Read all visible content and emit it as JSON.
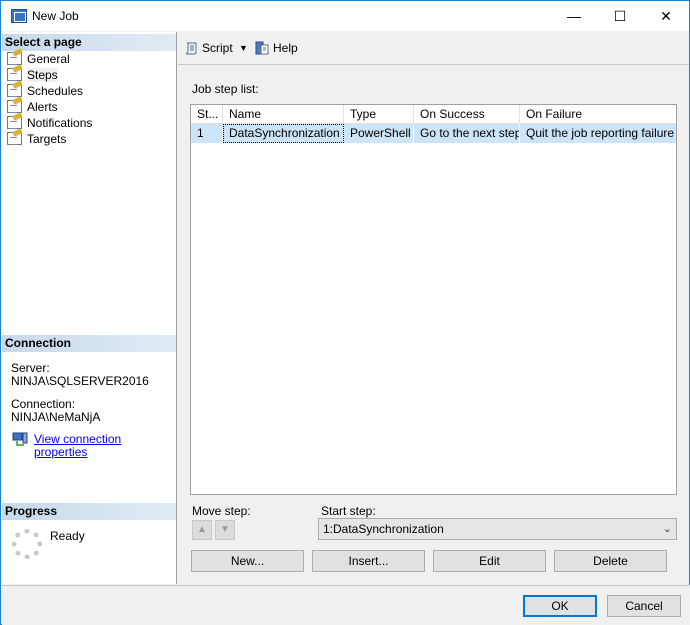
{
  "window": {
    "title": "New Job",
    "minimize": "—",
    "maximize": "☐",
    "close": "✕"
  },
  "left_panel": {
    "select_page_header": "Select a page",
    "pages": [
      {
        "label": "General",
        "icon": "page-icon"
      },
      {
        "label": "Steps",
        "icon": "page-icon",
        "selected": true
      },
      {
        "label": "Schedules",
        "icon": "page-icon"
      },
      {
        "label": "Alerts",
        "icon": "page-icon"
      },
      {
        "label": "Notifications",
        "icon": "page-icon"
      },
      {
        "label": "Targets",
        "icon": "page-icon"
      }
    ],
    "connection_header": "Connection",
    "server_label": "Server:",
    "server_value": "NINJA\\SQLSERVER2016",
    "connection_label": "Connection:",
    "connection_value": "NINJA\\NeMaNjA",
    "view_connection_link": "View connection properties",
    "progress_header": "Progress",
    "progress_status": "Ready"
  },
  "toolbar": {
    "script_label": "Script",
    "script_dropdown": "▼",
    "help_label": "Help"
  },
  "main": {
    "job_step_list_label": "Job step list:",
    "columns": [
      "St...",
      "Name",
      "Type",
      "On Success",
      "On Failure"
    ],
    "rows": [
      {
        "step": "1",
        "name": "DataSynchronization",
        "type": "PowerShell",
        "on_success": "Go to the next step",
        "on_failure": "Quit the job reporting failure"
      }
    ],
    "move_step_label": "Move step:",
    "move_up": "▲",
    "move_down": "▼",
    "start_step_label": "Start step:",
    "start_step_value": "1:DataSynchronization",
    "combo_arrow": "⌄",
    "buttons": {
      "new": "New...",
      "insert": "Insert...",
      "edit": "Edit",
      "delete": "Delete"
    }
  },
  "footer": {
    "ok": "OK",
    "cancel": "Cancel"
  },
  "colors": {
    "accent_border": "#1883d7",
    "selected_row": "#cce4f7",
    "section_header": "#c7d9eb",
    "link": "#0000ee"
  }
}
